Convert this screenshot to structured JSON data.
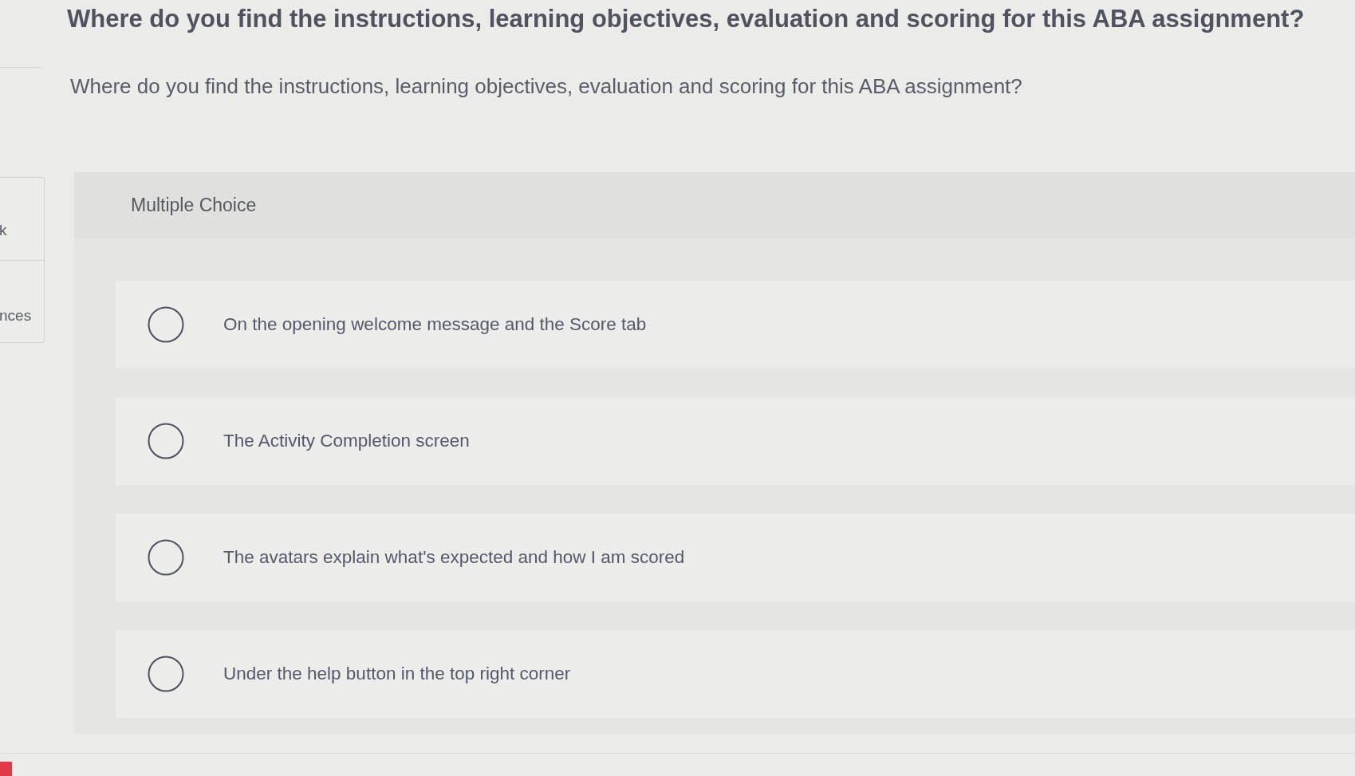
{
  "sidebar": {
    "items": [
      {
        "label": "k"
      },
      {
        "label": "nces"
      }
    ]
  },
  "title": "Where do you find the instructions, learning objectives, evaluation and scoring for this ABA assignment?",
  "question": {
    "text": "Where do you find the instructions, learning objectives, evaluation and scoring for this ABA assignment?",
    "type_label": "Multiple Choice",
    "options": [
      {
        "label": "On the opening welcome message and the Score tab",
        "selected": false
      },
      {
        "label": "The Activity Completion screen",
        "selected": false
      },
      {
        "label": "The avatars explain what's expected and how I am scored",
        "selected": false
      },
      {
        "label": "Under the help button in the top right corner",
        "selected": false
      }
    ]
  }
}
